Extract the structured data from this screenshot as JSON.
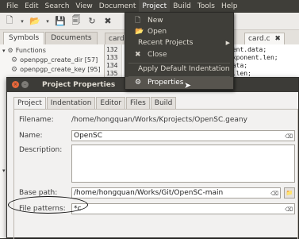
{
  "menubar": [
    "File",
    "Edit",
    "Search",
    "View",
    "Document",
    "Project",
    "Build",
    "Tools",
    "Help"
  ],
  "sidebar": {
    "tabs": [
      "Symbols",
      "Documents"
    ],
    "tree": {
      "root": "Functions",
      "items": [
        "openpgp_create_dir [57]",
        "openpgp_create_key [95]"
      ]
    }
  },
  "editor": {
    "tabs": [
      "card-",
      "card.c"
    ],
    "line_numbers": [
      "132",
      "133",
      "134",
      "135"
    ],
    "code_lines": [
      "ment.data;",
      "exponent.len;",
      "data;",
      "p.len;"
    ]
  },
  "project_menu": {
    "items": [
      {
        "icon": "new-icon",
        "label": "New"
      },
      {
        "icon": "open-icon",
        "label": "Open"
      },
      {
        "icon": "",
        "label": "Recent Projects"
      },
      {
        "icon": "close-icon",
        "label": "Close"
      },
      {
        "icon": "",
        "label": "Apply Default Indentation"
      },
      {
        "icon": "gear-icon",
        "label": "Properties"
      }
    ]
  },
  "dialog": {
    "title": "Project Properties",
    "tabs": [
      "Project",
      "Indentation",
      "Editor",
      "Files",
      "Build"
    ],
    "filename_label": "Filename:",
    "filename_value": "/home/hongquan/Works/Kprojects/OpenSC.geany",
    "name_label": "Name:",
    "name_value": "OpenSC",
    "description_label": "Description:",
    "description_value": "",
    "base_path_label": "Base path:",
    "base_path_value": "/home/hongquan/Works/Git/OpenSC-main",
    "file_patterns_label": "File patterns:",
    "file_patterns_value": "*c"
  }
}
